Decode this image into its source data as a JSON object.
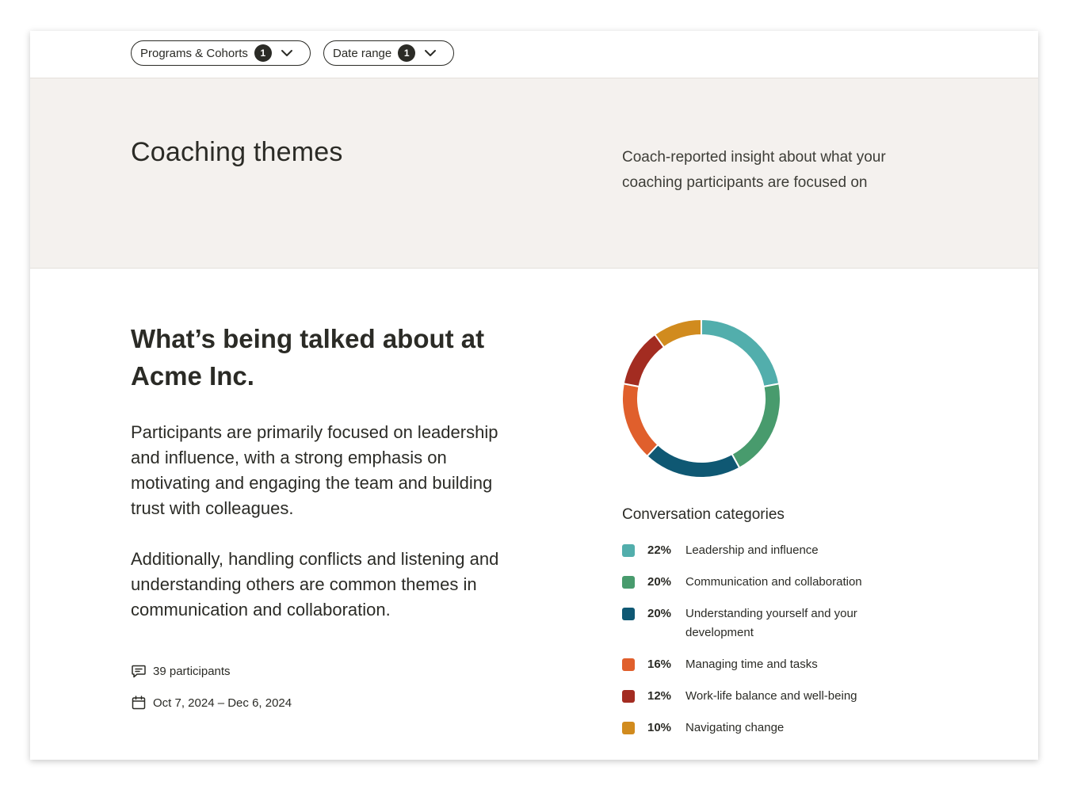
{
  "filters": {
    "programs": {
      "label": "Programs & Cohorts",
      "count": "1"
    },
    "date_range": {
      "label": "Date range",
      "count": "1"
    }
  },
  "header": {
    "title": "Coaching themes",
    "subtitle": "Coach-reported insight about what your coaching participants are focused on"
  },
  "main": {
    "heading": "What’s being talked about at Acme Inc.",
    "paragraph1": "Participants are primarily focused on leadership and influence, with a strong emphasis on motivating and engaging the team and building trust with colleagues.",
    "paragraph2": "Additionally, handling conflicts and listening and understanding others are common themes in communication and collaboration.",
    "participants": "39 participants",
    "date_span": "Oct 7, 2024 – Dec 6, 2024"
  },
  "icons": {
    "participants": "chat-bubble-icon",
    "dates": "calendar-icon",
    "dropdown": "chevron-down-icon"
  },
  "chart_data": {
    "type": "pie",
    "title": "Conversation categories",
    "categories": [
      "Leadership and influence",
      "Communication and collaboration",
      "Understanding yourself and your development",
      "Managing time and tasks",
      "Work-life balance and well-being",
      "Navigating change"
    ],
    "values": [
      22,
      20,
      20,
      16,
      12,
      10
    ],
    "value_labels": [
      "22%",
      "20%",
      "20%",
      "16%",
      "12%",
      "10%"
    ],
    "colors": [
      "#52aeac",
      "#489b6d",
      "#0f5873",
      "#e05f2c",
      "#a32c21",
      "#d18b1e"
    ],
    "legend": "below"
  }
}
